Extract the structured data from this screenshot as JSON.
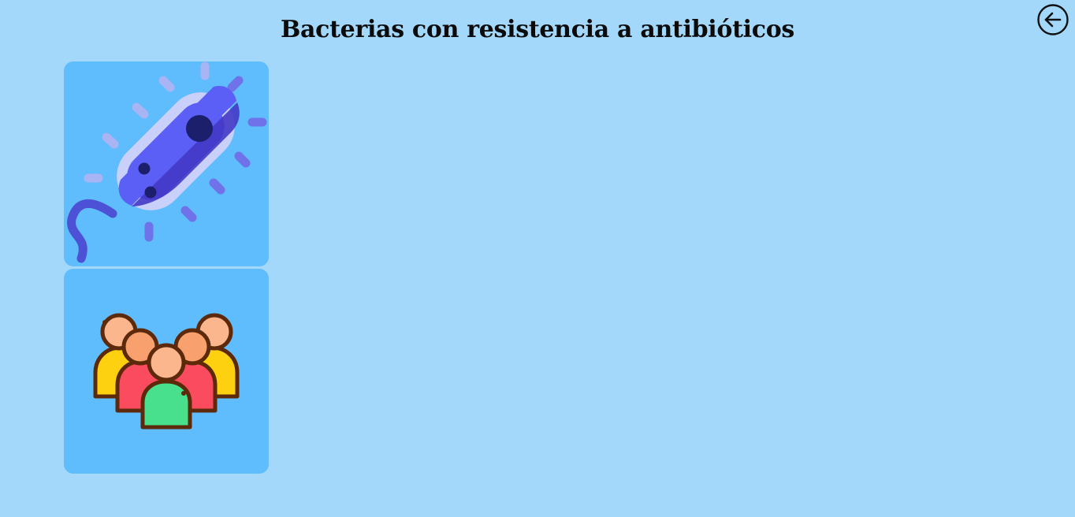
{
  "header": {
    "title": "Bacterias con resistencia a antibióticos",
    "back_icon": "arrow-left-circle-icon"
  },
  "cards": [
    {
      "icon": "bacteria-icon",
      "accent": "#5b5ff5"
    },
    {
      "icon": "people-group-icon",
      "accent": "#48e08c"
    }
  ],
  "colors": {
    "background": "#a3d8fa",
    "card": "#5fbcfd"
  }
}
